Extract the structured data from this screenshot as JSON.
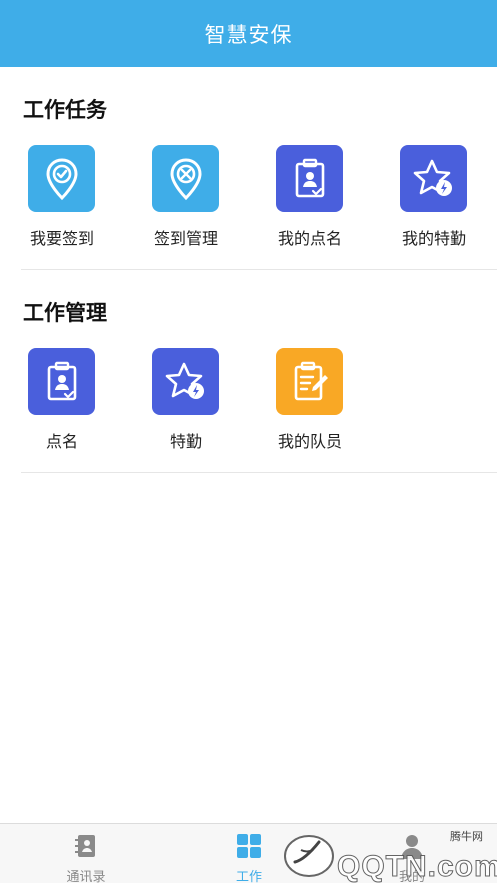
{
  "header": {
    "title": "智慧安保"
  },
  "sections": [
    {
      "title": "工作任务",
      "items": [
        {
          "label": "我要签到",
          "icon": "location-check-icon",
          "color": "#3fade8"
        },
        {
          "label": "签到管理",
          "icon": "location-tools-icon",
          "color": "#3fade8"
        },
        {
          "label": "我的点名",
          "icon": "clipboard-person-icon",
          "color": "#4a5fdc"
        },
        {
          "label": "我的特勤",
          "icon": "star-lightning-icon",
          "color": "#4a5fdc"
        }
      ]
    },
    {
      "title": "工作管理",
      "items": [
        {
          "label": "点名",
          "icon": "clipboard-person-icon",
          "color": "#4a5fdc"
        },
        {
          "label": "特勤",
          "icon": "star-lightning-icon",
          "color": "#4a5fdc"
        },
        {
          "label": "我的队员",
          "icon": "clipboard-edit-icon",
          "color": "#f9a825"
        }
      ]
    }
  ],
  "tabbar": {
    "active_color": "#3fade8",
    "items": [
      {
        "label": "通讯录",
        "icon": "contacts-book-icon"
      },
      {
        "label": "工作",
        "icon": "grid-icon"
      },
      {
        "label": "我的",
        "icon": "person-icon"
      }
    ]
  },
  "watermark": {
    "text": "QQTN.com",
    "small": "腾牛网"
  }
}
